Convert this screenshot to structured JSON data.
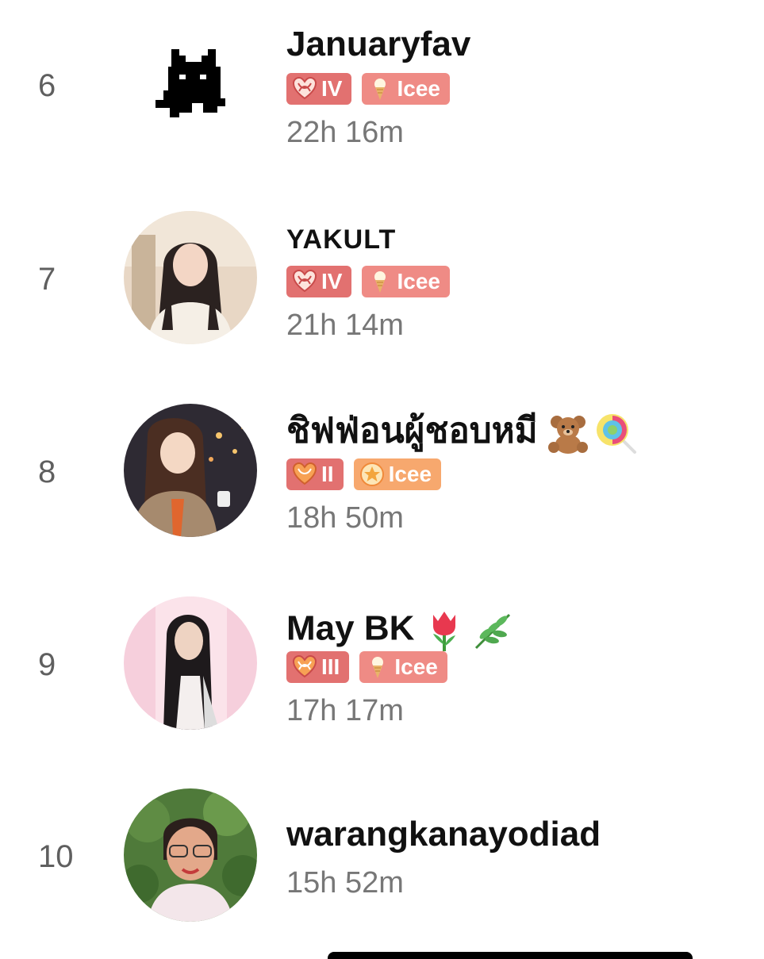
{
  "leaderboard": {
    "entries": [
      {
        "rank": "6",
        "username": "Januaryfav",
        "level_badge": "IV",
        "tier_badge": "Icee",
        "duration": "22h 16m",
        "avatar": "pixel-cat-avatar"
      },
      {
        "rank": "7",
        "username": "YAKULT",
        "level_badge": "IV",
        "tier_badge": "Icee",
        "duration": "21h 14m",
        "avatar": "photo-avatar"
      },
      {
        "rank": "8",
        "username": "ชิฟฟ่อนผู้ชอบหมี",
        "username_emojis": [
          "teddy-bear-emoji",
          "lollipop-emoji"
        ],
        "level_badge": "II",
        "tier_badge": "Icee",
        "duration": "18h 50m",
        "avatar": "illustrated-avatar"
      },
      {
        "rank": "9",
        "username": "May BK",
        "username_emojis": [
          "tulip-emoji",
          "herb-emoji"
        ],
        "level_badge": "III",
        "tier_badge": "Icee",
        "duration": "17h 17m",
        "avatar": "photo-avatar"
      },
      {
        "rank": "10",
        "username": "warangkanayodiad",
        "duration": "15h 52m",
        "avatar": "photo-avatar"
      }
    ]
  },
  "colors": {
    "level_badge_bg": "#e27170",
    "tier_badge_bg": "#ef8b85",
    "tier_badge_orange_bg": "#f7a86e",
    "rank_text": "#5f5f5f",
    "time_text": "#777777"
  },
  "icons": {
    "level_badge_icon": "heart-knot-icon",
    "tier_badge_icon": "ice-cream-icon",
    "tier_badge_icon_alt": "star-icon"
  }
}
